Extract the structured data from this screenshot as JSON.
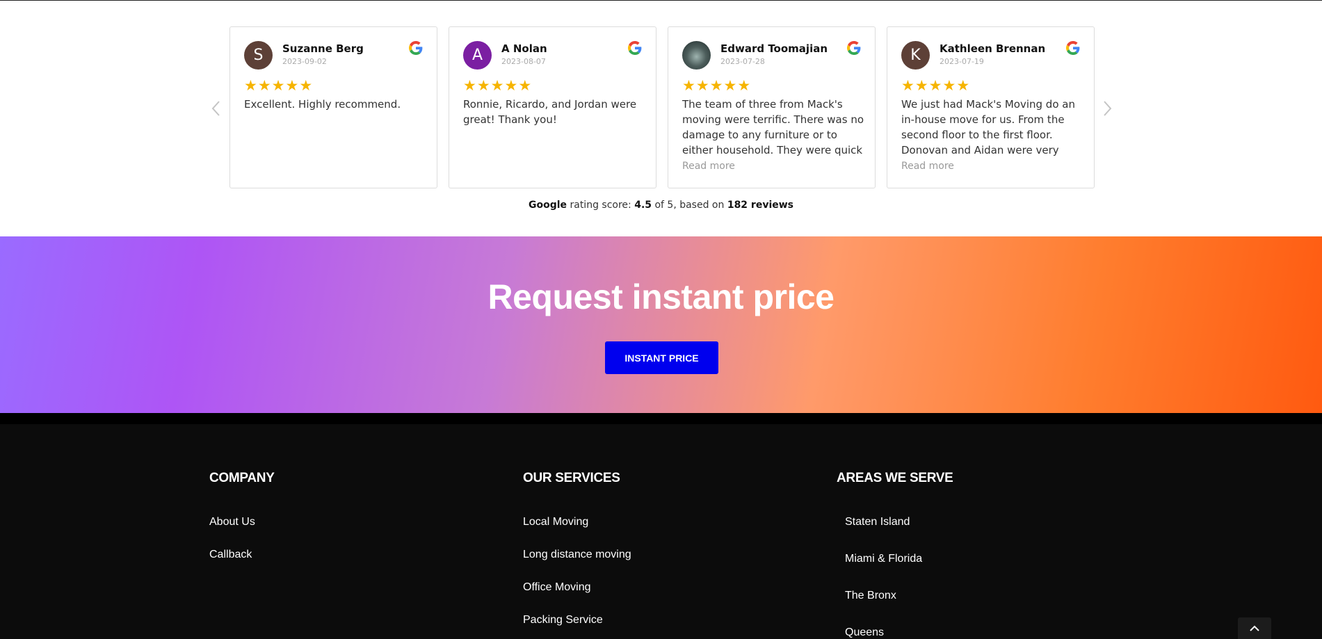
{
  "reviews": {
    "items": [
      {
        "initial": "S",
        "avatar_color": "#5d4037",
        "name": "Suzanne Berg",
        "date": "2023-09-02",
        "stars": 5,
        "text": "Excellent. Highly recommend.",
        "read_more": ""
      },
      {
        "initial": "A",
        "avatar_color": "#7b1fa2",
        "name": "A Nolan",
        "date": "2023-08-07",
        "stars": 5,
        "text": "Ronnie, Ricardo, and Jordan were great! Thank you!",
        "read_more": ""
      },
      {
        "initial": "",
        "avatar_color": "#3a4a4a",
        "name": "Edward Toomajian",
        "date": "2023-07-28",
        "stars": 5,
        "text": "The team of three from Mack's moving were terrific. There was no damage to any furniture or to either household. They were quick and...",
        "read_more": "Read more"
      },
      {
        "initial": "K",
        "avatar_color": "#5d4037",
        "name": "Kathleen Brennan",
        "date": "2023-07-19",
        "stars": 5,
        "text": "We just had Mack's Moving do an in-house move for us. From the second floor to the first floor. Donovan and Aidan were very professional. The...",
        "read_more": "Read more"
      }
    ],
    "summary": {
      "brand": "Google",
      "prefix": "rating score:",
      "score": "4.5",
      "of": "of 5, based on",
      "count": "182 reviews"
    }
  },
  "cta": {
    "title": "Request instant price",
    "button": "INSTANT PRICE"
  },
  "footer": {
    "company": {
      "heading": "COMPANY",
      "links": [
        "About Us",
        "Callback"
      ]
    },
    "services": {
      "heading": "OUR SERVICES",
      "links": [
        "Local Moving",
        "Long distance moving",
        "Office Moving",
        "Packing Service"
      ]
    },
    "areas": {
      "heading": "AREAS WE SERVE",
      "links": [
        "Staten Island",
        "Miami & Florida",
        "The Bronx",
        "Queens"
      ]
    }
  },
  "colors": {
    "star": "#f6b400",
    "cta_button": "#0000ee",
    "footer_bg": "#0c0c0c"
  },
  "icons": {
    "prev": "chevron-left-icon",
    "next": "chevron-right-icon",
    "google": "google-g-icon",
    "scroll_top": "chevron-up-icon"
  }
}
